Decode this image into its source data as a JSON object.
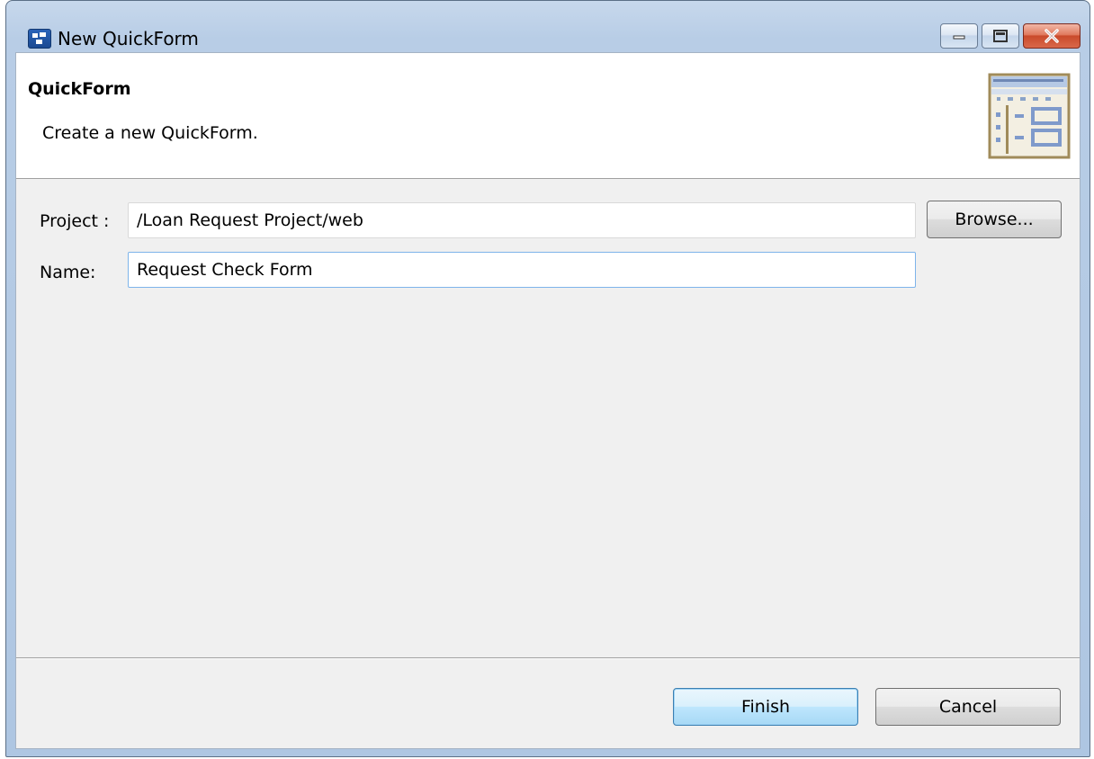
{
  "window": {
    "title": "New QuickForm"
  },
  "titlebar_buttons": {
    "minimize": "minimize-icon",
    "maximize": "maximize-icon",
    "close": "close-icon"
  },
  "header": {
    "title": "QuickForm",
    "description": "Create a new QuickForm.",
    "image": "form-layout-icon"
  },
  "form": {
    "project_label": "Project :",
    "project_value": "/Loan Request Project/web",
    "browse_label": "Browse...",
    "name_label": "Name:",
    "name_value": "Request Check Form"
  },
  "footer": {
    "finish_label": "Finish",
    "cancel_label": "Cancel"
  }
}
